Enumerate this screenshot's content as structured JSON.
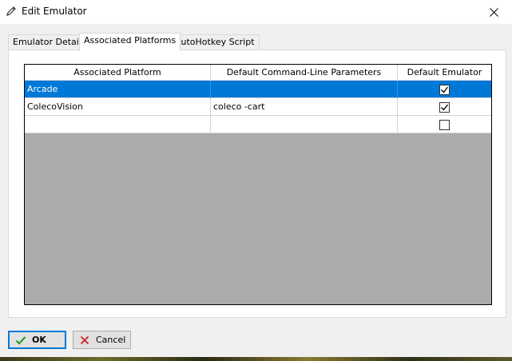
{
  "window": {
    "title": "Edit Emulator",
    "icon": "pencil-icon",
    "close_icon": "close-icon"
  },
  "tabs": [
    {
      "label": "Emulator Details",
      "active": false
    },
    {
      "label": "Associated Platforms",
      "active": true
    },
    {
      "label": "AutoHotkey Script",
      "active": false
    }
  ],
  "grid": {
    "columns": [
      "Associated Platform",
      "Default Command-Line Parameters",
      "Default Emulator"
    ],
    "rows": [
      {
        "platform": "Arcade",
        "params": "",
        "default": true,
        "selected": true
      },
      {
        "platform": "ColecoVision",
        "params": "coleco -cart",
        "default": true,
        "selected": false
      },
      {
        "platform": "",
        "params": "",
        "default": false,
        "selected": false
      }
    ]
  },
  "buttons": {
    "ok_label": "OK",
    "ok_icon": "checkmark-icon",
    "cancel_label": "Cancel",
    "cancel_icon": "x-icon"
  },
  "colors": {
    "selection": "#0078d7",
    "grid_empty": "#ababab",
    "ok_check": "#2e9e2e",
    "cancel_x": "#d13438"
  }
}
